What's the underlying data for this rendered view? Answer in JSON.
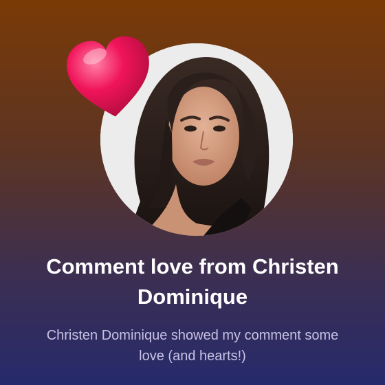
{
  "notification": {
    "title": "Comment love from Christen Dominique",
    "message": "Christen Dominique showed my comment some love (and hearts!)",
    "avatar_icon": "creator-avatar",
    "reaction_icon": "heart-icon",
    "colors": {
      "heart": "#f0145a",
      "title": "#ffffff",
      "message": "#c9c2e4",
      "gradient_top": "#7a3a06",
      "gradient_bottom": "#262a6c"
    }
  }
}
